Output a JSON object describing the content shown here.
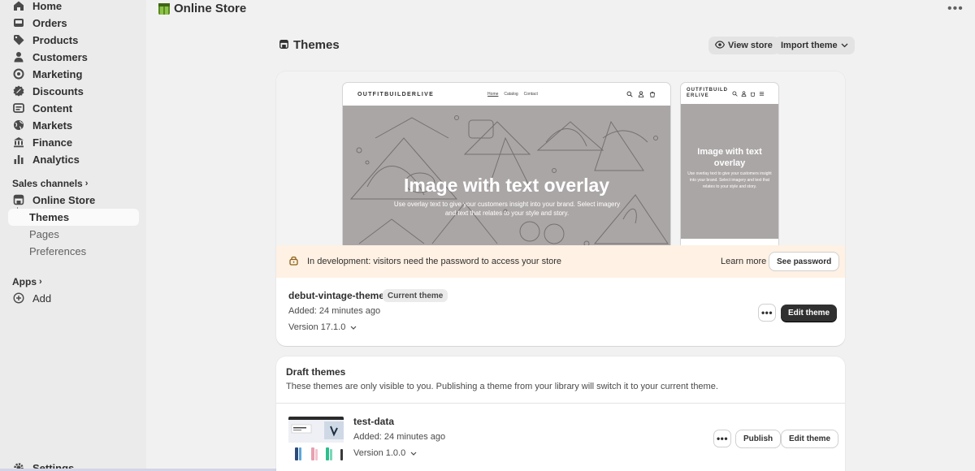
{
  "app": {
    "title": "Online Store"
  },
  "sidebar": {
    "items": [
      {
        "label": "Home",
        "icon": "home-icon"
      },
      {
        "label": "Orders",
        "icon": "inbox-icon"
      },
      {
        "label": "Products",
        "icon": "tag-icon"
      },
      {
        "label": "Customers",
        "icon": "person-icon"
      },
      {
        "label": "Marketing",
        "icon": "target-icon"
      },
      {
        "label": "Discounts",
        "icon": "discount-icon"
      },
      {
        "label": "Content",
        "icon": "content-icon"
      },
      {
        "label": "Markets",
        "icon": "globe-icon"
      },
      {
        "label": "Finance",
        "icon": "bank-icon"
      },
      {
        "label": "Analytics",
        "icon": "bar-chart-icon"
      }
    ],
    "sales_channels_label": "Sales channels",
    "online_store_label": "Online Store",
    "sub_items": [
      {
        "label": "Themes",
        "active": true
      },
      {
        "label": "Pages",
        "active": false
      },
      {
        "label": "Preferences",
        "active": false
      }
    ],
    "apps_label": "Apps",
    "add_label": "Add",
    "settings_label": "Settings"
  },
  "page": {
    "title": "Themes",
    "view_store_label": "View store",
    "import_theme_label": "Import theme"
  },
  "current_theme": {
    "preview": {
      "store_logo": "OUTFITBUILDERLIVE",
      "mobile_logo": "OUTFITBUILD ERLIVE",
      "menu": [
        "Home",
        "Catalog",
        "Contact"
      ],
      "hero_title": "Image with text overlay",
      "hero_text": "Use overlay text to give your customers insight into your brand. Select imagery and text that relates to your style and story."
    },
    "banner_text": "In development: visitors need the password to access your store",
    "learn_more_label": "Learn more",
    "see_password_label": "See password",
    "name": "debut-vintage-theme",
    "badge": "Current theme",
    "added": "Added: 24 minutes ago",
    "version": "Version 17.1.0",
    "edit_label": "Edit theme",
    "more_label": "•••"
  },
  "draft": {
    "title": "Draft themes",
    "description": "These themes are only visible to you. Publishing a theme from your library will switch it to your current theme.",
    "themes": [
      {
        "name": "test-data",
        "added": "Added: 24 minutes ago",
        "version": "Version 1.0.0",
        "publish_label": "Publish",
        "edit_label": "Edit theme",
        "more_label": "•••"
      }
    ]
  },
  "colors": {
    "primary_button": "#303030",
    "banner_bg": "#fff1e3",
    "hero_bg": "#aba6a6",
    "sidebar_bg": "#ebebeb"
  }
}
